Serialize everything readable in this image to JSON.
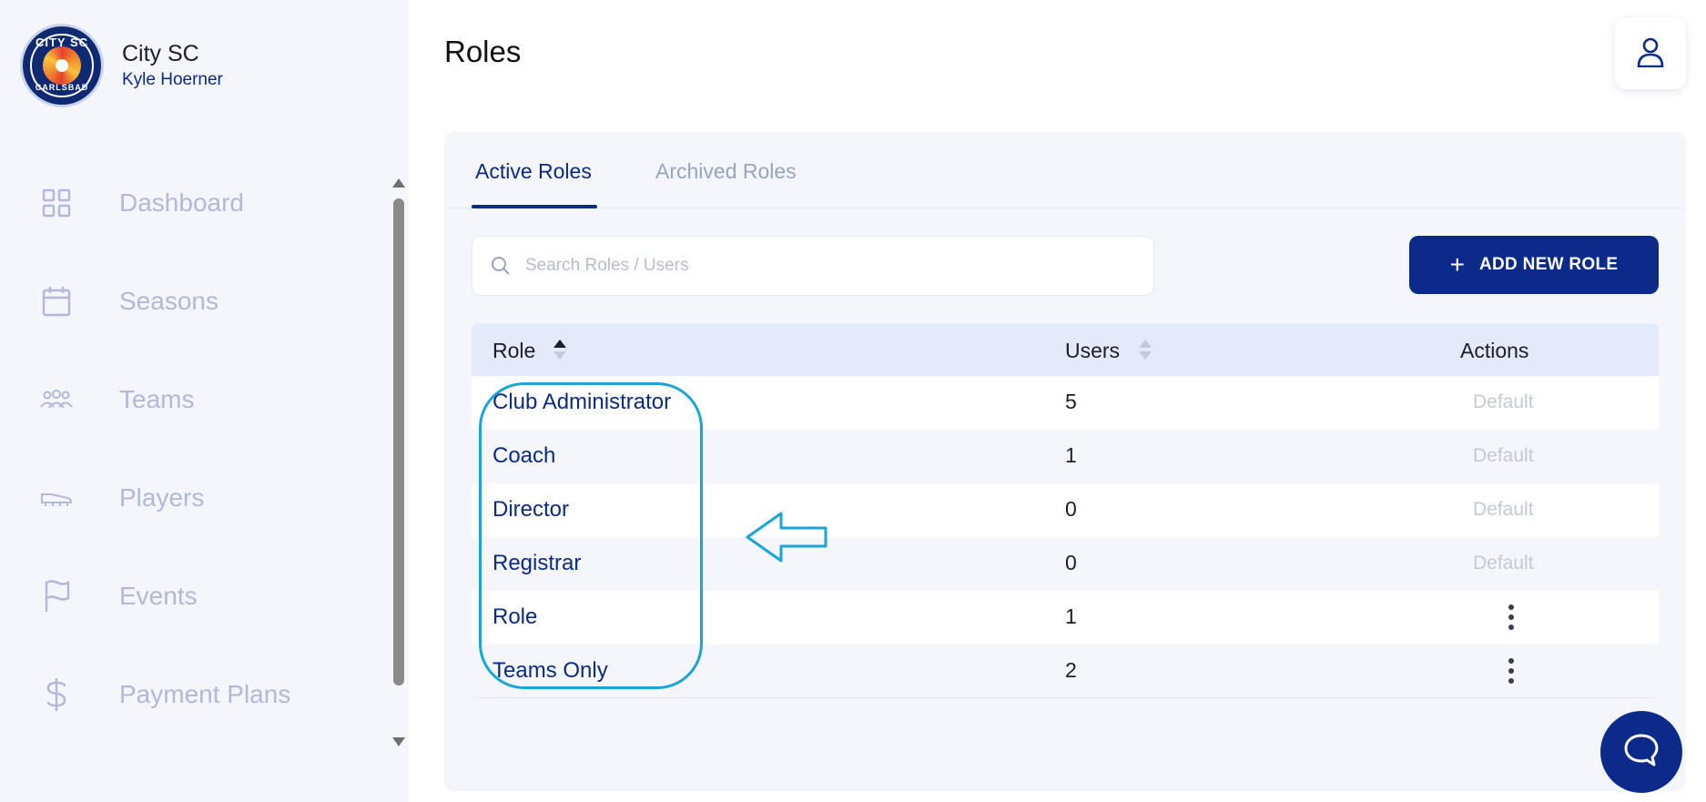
{
  "brand": {
    "club_name": "City SC",
    "user_name": "Kyle Hoerner",
    "logo_top_text": "CITY SC",
    "logo_bottom_text": "CARLSBAD"
  },
  "sidebar": {
    "items": [
      {
        "label": "Dashboard",
        "icon": "grid-icon"
      },
      {
        "label": "Seasons",
        "icon": "calendar-icon"
      },
      {
        "label": "Teams",
        "icon": "people-icon"
      },
      {
        "label": "Players",
        "icon": "cleat-icon"
      },
      {
        "label": "Events",
        "icon": "flag-icon"
      },
      {
        "label": "Payment Plans",
        "icon": "dollar-icon"
      }
    ]
  },
  "page": {
    "title": "Roles"
  },
  "tabs": {
    "active": "Active Roles",
    "archived": "Archived Roles"
  },
  "search": {
    "placeholder": "Search Roles / Users",
    "value": ""
  },
  "add_button": {
    "label": "ADD NEW ROLE"
  },
  "table": {
    "headers": {
      "role": "Role",
      "users": "Users",
      "actions": "Actions"
    },
    "rows": [
      {
        "role": "Club Administrator",
        "users": "5",
        "action": "Default"
      },
      {
        "role": "Coach",
        "users": "1",
        "action": "Default"
      },
      {
        "role": "Director",
        "users": "0",
        "action": "Default"
      },
      {
        "role": "Registrar",
        "users": "0",
        "action": "Default"
      },
      {
        "role": "Role",
        "users": "1",
        "action": "menu"
      },
      {
        "role": "Teams Only",
        "users": "2",
        "action": "menu"
      }
    ]
  },
  "colors": {
    "primary": "#0b2a8a",
    "sidebar_bg": "#f4f6fb",
    "nav_text": "#b3b8db",
    "annotation": "#1aa4d8"
  }
}
